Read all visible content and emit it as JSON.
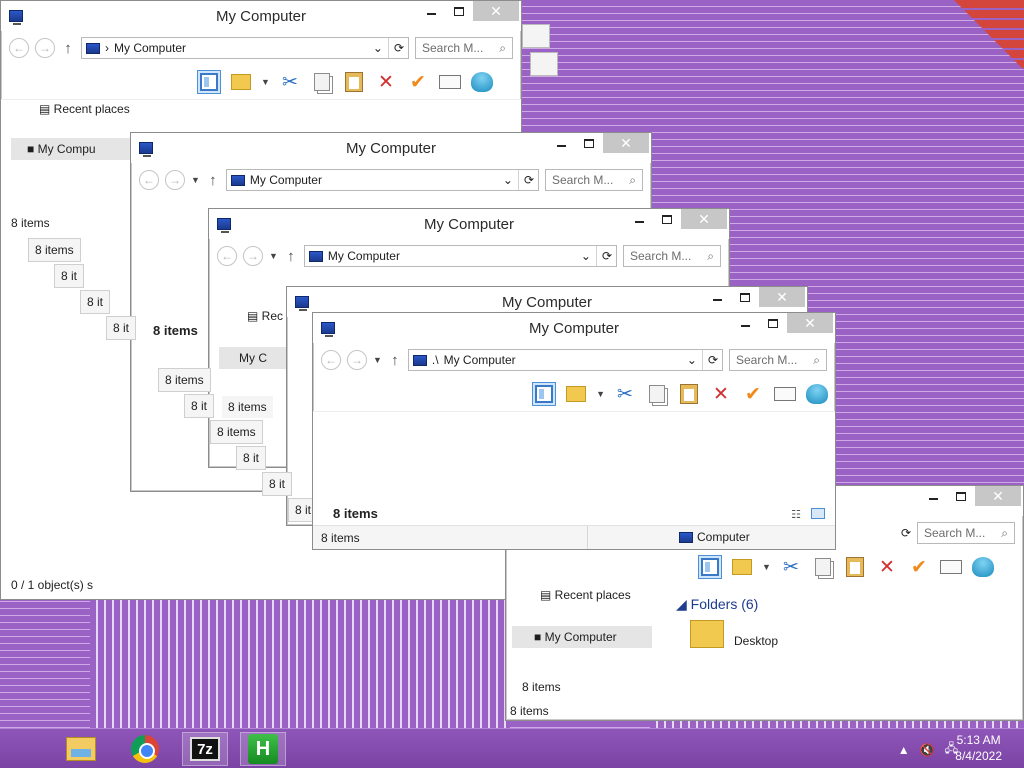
{
  "window": {
    "title": "My Computer",
    "address_path": "My Computer",
    "search_placeholder": "Search M...",
    "items_count": "8 items",
    "status_selection": "0 / 1 object(s) s",
    "status_location": "Computer",
    "address_prefix": ".\\"
  },
  "navpane": {
    "recent_places": "Recent places",
    "my_computer": "My Computer",
    "recent_truncated": "Rec",
    "mycomp_truncated": "My C",
    "my_compu": "My Compu"
  },
  "content": {
    "folders_header": "Folders (6)",
    "desktop": "Desktop"
  },
  "stack_fragments": [
    "8 it",
    "8 it",
    "8 it",
    "8 it",
    "8 it",
    "8 it",
    "8 it",
    "8 it"
  ],
  "taskbar": {
    "time": "5:13 AM",
    "date": "8/4/2022",
    "apps": [
      "file-explorer",
      "chrome",
      "7-zip",
      "h-app"
    ],
    "sevenz_label": "7z",
    "h_label": "H"
  }
}
